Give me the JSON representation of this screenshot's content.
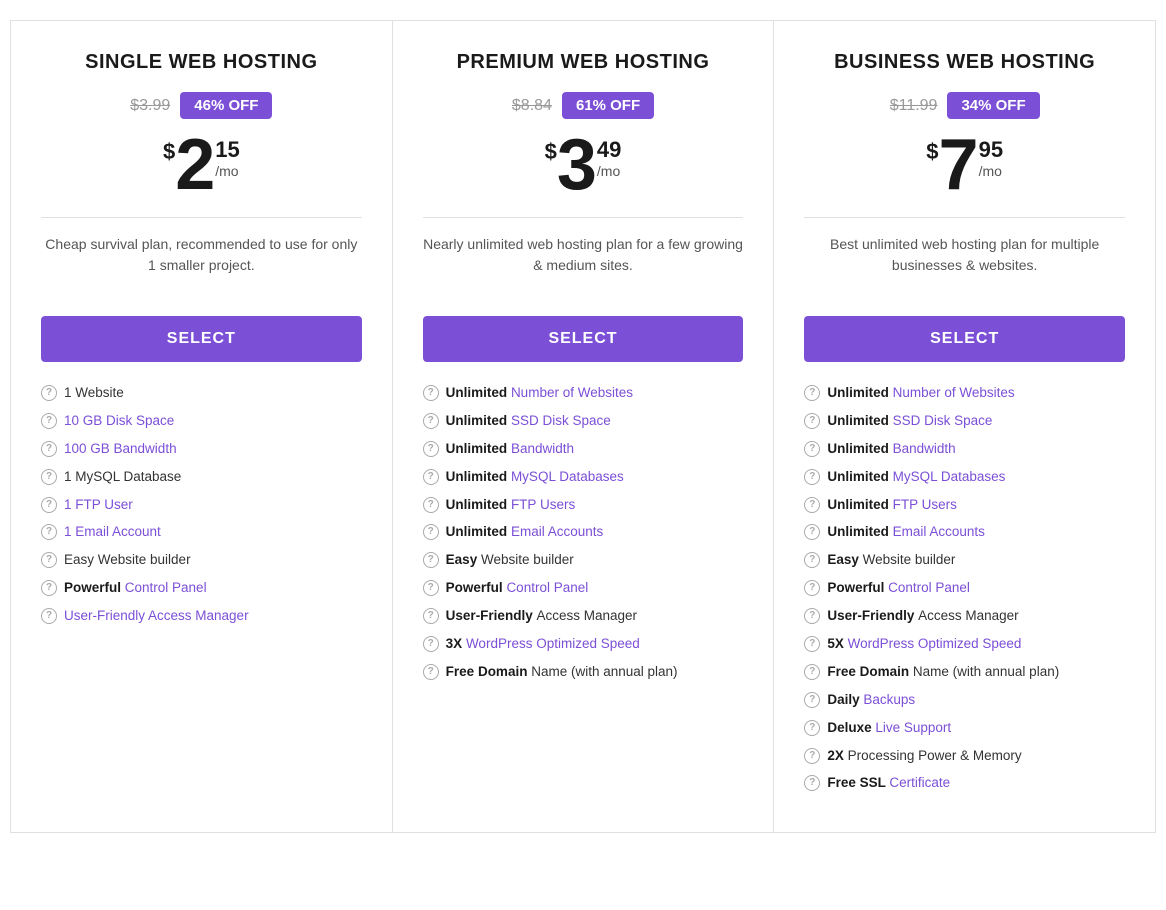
{
  "plans": [
    {
      "id": "single",
      "title": "SINGLE WEB HOSTING",
      "original_price": "$3.99",
      "discount": "46% OFF",
      "price_dollar": "$",
      "price_main": "2",
      "price_cents": "15",
      "price_mo": "/mo",
      "description": "Cheap survival plan, recommended to use for only 1 smaller project.",
      "select_label": "SELECT",
      "features": [
        {
          "bold": "",
          "link": "",
          "plain": "1 Website",
          "has_link": false
        },
        {
          "bold": "",
          "link": "10 GB Disk Space",
          "plain": "",
          "has_link": true
        },
        {
          "bold": "",
          "link": "100 GB Bandwidth",
          "plain": "",
          "has_link": true
        },
        {
          "bold": "",
          "link": "",
          "plain": "1 MySQL Database",
          "has_link": false
        },
        {
          "bold": "",
          "link": "1 FTP User",
          "plain": "",
          "has_link": true
        },
        {
          "bold": "",
          "link": "1 Email Account",
          "plain": "",
          "has_link": true
        },
        {
          "bold": "",
          "link": "",
          "plain": "Easy Website builder",
          "has_link": false
        },
        {
          "bold": "Powerful",
          "link": "Control Panel",
          "plain": "",
          "has_link": true
        },
        {
          "bold": "",
          "link": "User-Friendly Access Manager",
          "plain": "",
          "has_link": true
        }
      ]
    },
    {
      "id": "premium",
      "title": "PREMIUM WEB HOSTING",
      "original_price": "$8.84",
      "discount": "61% OFF",
      "price_dollar": "$",
      "price_main": "3",
      "price_cents": "49",
      "price_mo": "/mo",
      "description": "Nearly unlimited web hosting plan for a few growing & medium sites.",
      "select_label": "SELECT",
      "features": [
        {
          "bold": "Unlimited",
          "link": "Number of Websites",
          "plain": "",
          "has_link": true
        },
        {
          "bold": "Unlimited",
          "link": "SSD Disk Space",
          "plain": "",
          "has_link": true
        },
        {
          "bold": "Unlimited",
          "link": "Bandwidth",
          "plain": "",
          "has_link": true
        },
        {
          "bold": "Unlimited",
          "link": "MySQL Databases",
          "plain": "",
          "has_link": true
        },
        {
          "bold": "Unlimited",
          "link": "FTP Users",
          "plain": "",
          "has_link": true
        },
        {
          "bold": "Unlimited",
          "link": "Email Accounts",
          "plain": "",
          "has_link": true
        },
        {
          "bold": "Easy",
          "link": "",
          "plain": "Website builder",
          "has_link": false
        },
        {
          "bold": "Powerful",
          "link": "Control Panel",
          "plain": "",
          "has_link": true
        },
        {
          "bold": "User-Friendly",
          "link": "",
          "plain": "Access Manager",
          "has_link": false
        },
        {
          "bold": "3X",
          "link": "WordPress Optimized Speed",
          "plain": "",
          "has_link": true
        },
        {
          "bold": "Free Domain",
          "link": "",
          "plain": "Name (with annual plan)",
          "has_link": false
        }
      ]
    },
    {
      "id": "business",
      "title": "BUSINESS WEB HOSTING",
      "original_price": "$11.99",
      "discount": "34% OFF",
      "price_dollar": "$",
      "price_main": "7",
      "price_cents": "95",
      "price_mo": "/mo",
      "description": "Best unlimited web hosting plan for multiple businesses & websites.",
      "select_label": "SELECT",
      "features": [
        {
          "bold": "Unlimited",
          "link": "Number of Websites",
          "plain": "",
          "has_link": true
        },
        {
          "bold": "Unlimited",
          "link": "SSD Disk Space",
          "plain": "",
          "has_link": true
        },
        {
          "bold": "Unlimited",
          "link": "Bandwidth",
          "plain": "",
          "has_link": true
        },
        {
          "bold": "Unlimited",
          "link": "MySQL Databases",
          "plain": "",
          "has_link": true
        },
        {
          "bold": "Unlimited",
          "link": "FTP Users",
          "plain": "",
          "has_link": true
        },
        {
          "bold": "Unlimited",
          "link": "Email Accounts",
          "plain": "",
          "has_link": true
        },
        {
          "bold": "Easy",
          "link": "",
          "plain": "Website builder",
          "has_link": false
        },
        {
          "bold": "Powerful",
          "link": "Control Panel",
          "plain": "",
          "has_link": true
        },
        {
          "bold": "User-Friendly",
          "link": "",
          "plain": "Access Manager",
          "has_link": false
        },
        {
          "bold": "5X",
          "link": "WordPress Optimized Speed",
          "plain": "",
          "has_link": true
        },
        {
          "bold": "Free Domain",
          "link": "",
          "plain": "Name (with annual plan)",
          "has_link": false
        },
        {
          "bold": "Daily",
          "link": "Backups",
          "plain": "",
          "has_link": true
        },
        {
          "bold": "Deluxe",
          "link": "Live Support",
          "plain": "",
          "has_link": true
        },
        {
          "bold": "2X",
          "link": "",
          "plain": "Processing Power & Memory",
          "has_link": false
        },
        {
          "bold": "Free SSL",
          "link": "Certificate",
          "plain": "",
          "has_link": true
        }
      ]
    }
  ]
}
